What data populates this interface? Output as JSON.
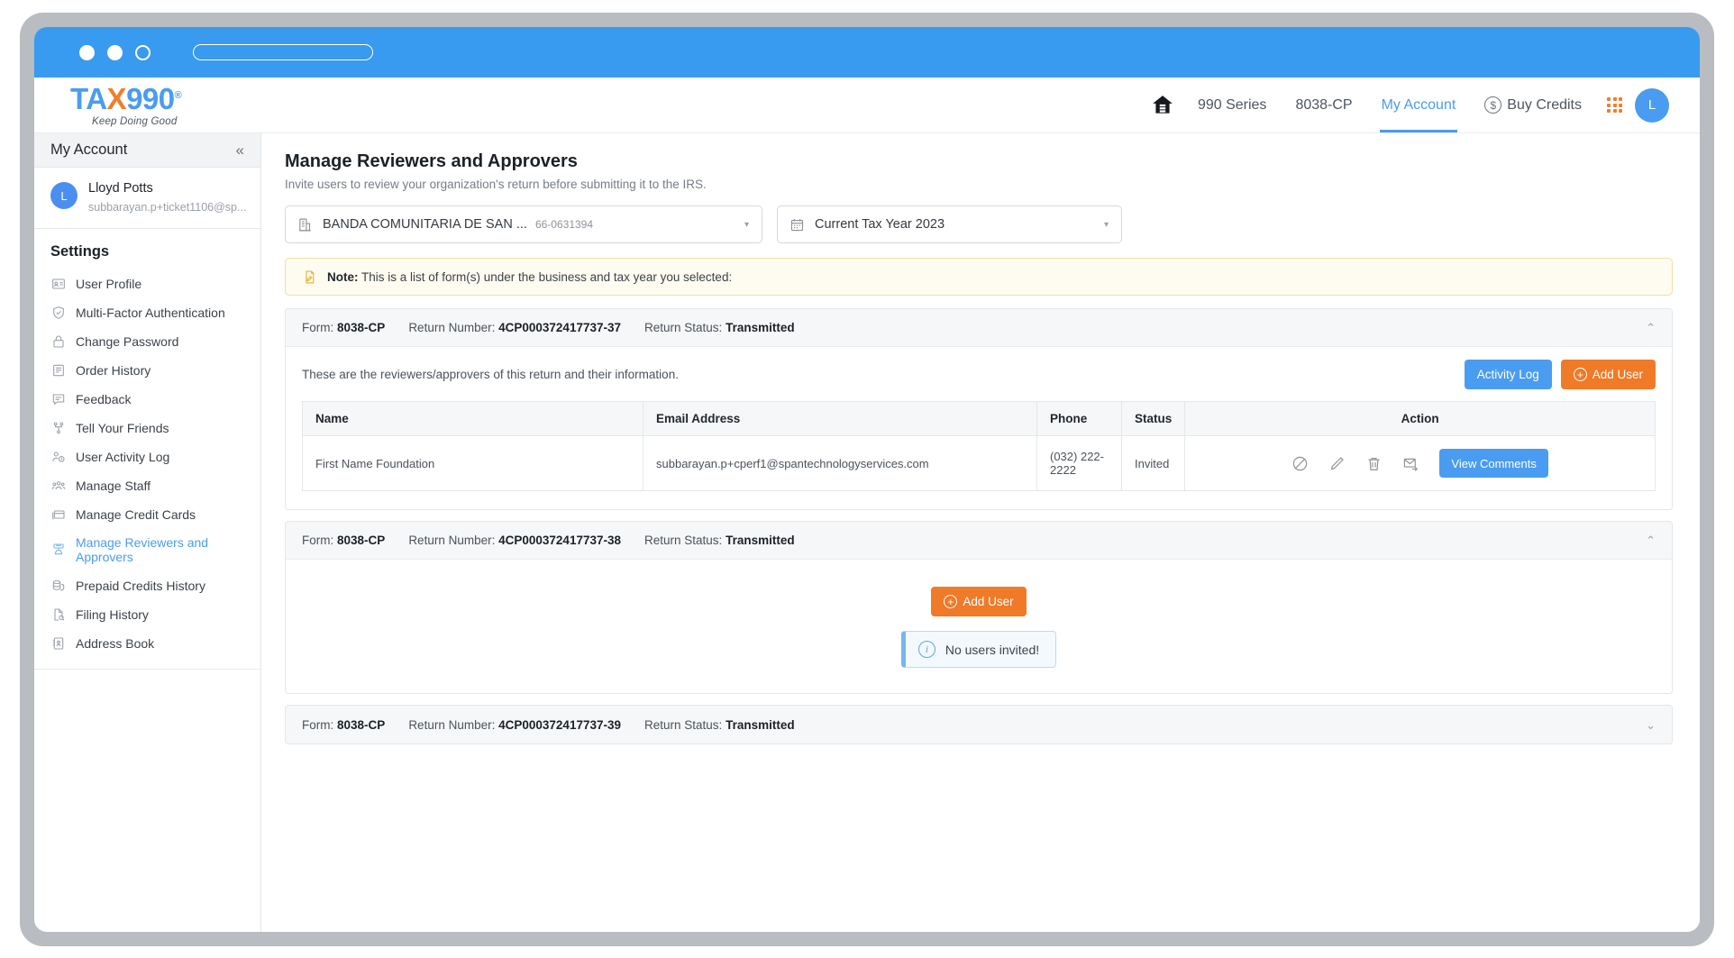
{
  "browser": {
    "dots": [
      "close-dot",
      "minimize-dot",
      "maximize-dot"
    ],
    "url_value": ""
  },
  "brand": {
    "name_part1": "TA",
    "name_x": "X",
    "name_part2": "990",
    "registered": "®",
    "tagline": "Keep Doing Good",
    "accent_blue": "#4a9cf0",
    "accent_orange": "#f07e2a"
  },
  "topnav": {
    "home_icon": "home-icon",
    "items": [
      {
        "label": "990 Series",
        "active": false
      },
      {
        "label": "8038-CP",
        "active": false
      },
      {
        "label": "My Account",
        "active": true
      }
    ],
    "buy_credits": "Buy Credits",
    "apps_icon": "apps-grid-icon",
    "avatar_initial": "L"
  },
  "sidebar": {
    "header_title": "My Account",
    "collapse_icon": "«",
    "user": {
      "initial": "L",
      "name": "Lloyd Potts",
      "email": "subbarayan.p+ticket1106@sp..."
    },
    "section_title": "Settings",
    "items": [
      {
        "label": "User Profile",
        "icon": "id-card-icon",
        "active": false
      },
      {
        "label": "Multi-Factor Authentication",
        "icon": "shield-check-icon",
        "active": false
      },
      {
        "label": "Change Password",
        "icon": "lock-icon",
        "active": false
      },
      {
        "label": "Order History",
        "icon": "order-history-icon",
        "active": false
      },
      {
        "label": "Feedback",
        "icon": "comment-icon",
        "active": false
      },
      {
        "label": "Tell Your Friends",
        "icon": "share-network-icon",
        "active": false
      },
      {
        "label": "User Activity Log",
        "icon": "user-clock-icon",
        "active": false
      },
      {
        "label": "Manage Staff",
        "icon": "users-group-icon",
        "active": false
      },
      {
        "label": "Manage Credit Cards",
        "icon": "credit-card-icon",
        "active": false
      },
      {
        "label": "Manage Reviewers and Approvers",
        "icon": "reviewers-icon",
        "active": true
      },
      {
        "label": "Prepaid Credits History",
        "icon": "coins-icon",
        "active": false
      },
      {
        "label": "Filing History",
        "icon": "file-search-icon",
        "active": false
      },
      {
        "label": "Address Book",
        "icon": "address-book-icon",
        "active": false
      }
    ]
  },
  "main": {
    "title": "Manage Reviewers and Approvers",
    "subtitle": "Invite users to review your organization's return before submitting it to the IRS.",
    "business_select": {
      "icon": "building-icon",
      "value": "BANDA COMUNITARIA DE SAN ...",
      "ein": "66-0631394",
      "caret": "▾"
    },
    "year_select": {
      "icon": "calendar-icon",
      "value": "Current Tax Year 2023",
      "caret": "▾"
    },
    "note": {
      "icon": "note-pencil-icon",
      "label": "Note:",
      "text": " This is a list of form(s) under the business and tax year you selected:"
    },
    "table_headers": [
      "Name",
      "Email Address",
      "Phone",
      "Status",
      "Action"
    ],
    "labels": {
      "form": "Form:",
      "return_number": "Return Number:",
      "return_status": "Return Status:"
    },
    "buttons": {
      "activity_log": "Activity Log",
      "add_user": "Add User",
      "view_comments": "View Comments",
      "plus": "+"
    },
    "accordions": [
      {
        "form": "8038-CP",
        "return_number": "4CP000372417737-37",
        "return_status": "Transmitted",
        "expanded": true,
        "chevron": "⌃",
        "description": "These are the reviewers/approvers of this return and their information.",
        "has_table": true,
        "rows": [
          {
            "name": "First Name Foundation",
            "email": "subbarayan.p+cperf1@spantechnologyservices.com",
            "phone": "(032) 222-2222",
            "status": "Invited",
            "actions": [
              "block-icon",
              "edit-pencil-icon",
              "trash-icon",
              "resend-email-icon"
            ]
          }
        ]
      },
      {
        "form": "8038-CP",
        "return_number": "4CP000372417737-38",
        "return_status": "Transmitted",
        "expanded": true,
        "chevron": "⌃",
        "has_table": false,
        "empty_message": "No users invited!",
        "empty_icon": "info-circle-icon"
      },
      {
        "form": "8038-CP",
        "return_number": "4CP000372417737-39",
        "return_status": "Transmitted",
        "expanded": false,
        "chevron": "⌄",
        "has_table": false
      }
    ]
  }
}
